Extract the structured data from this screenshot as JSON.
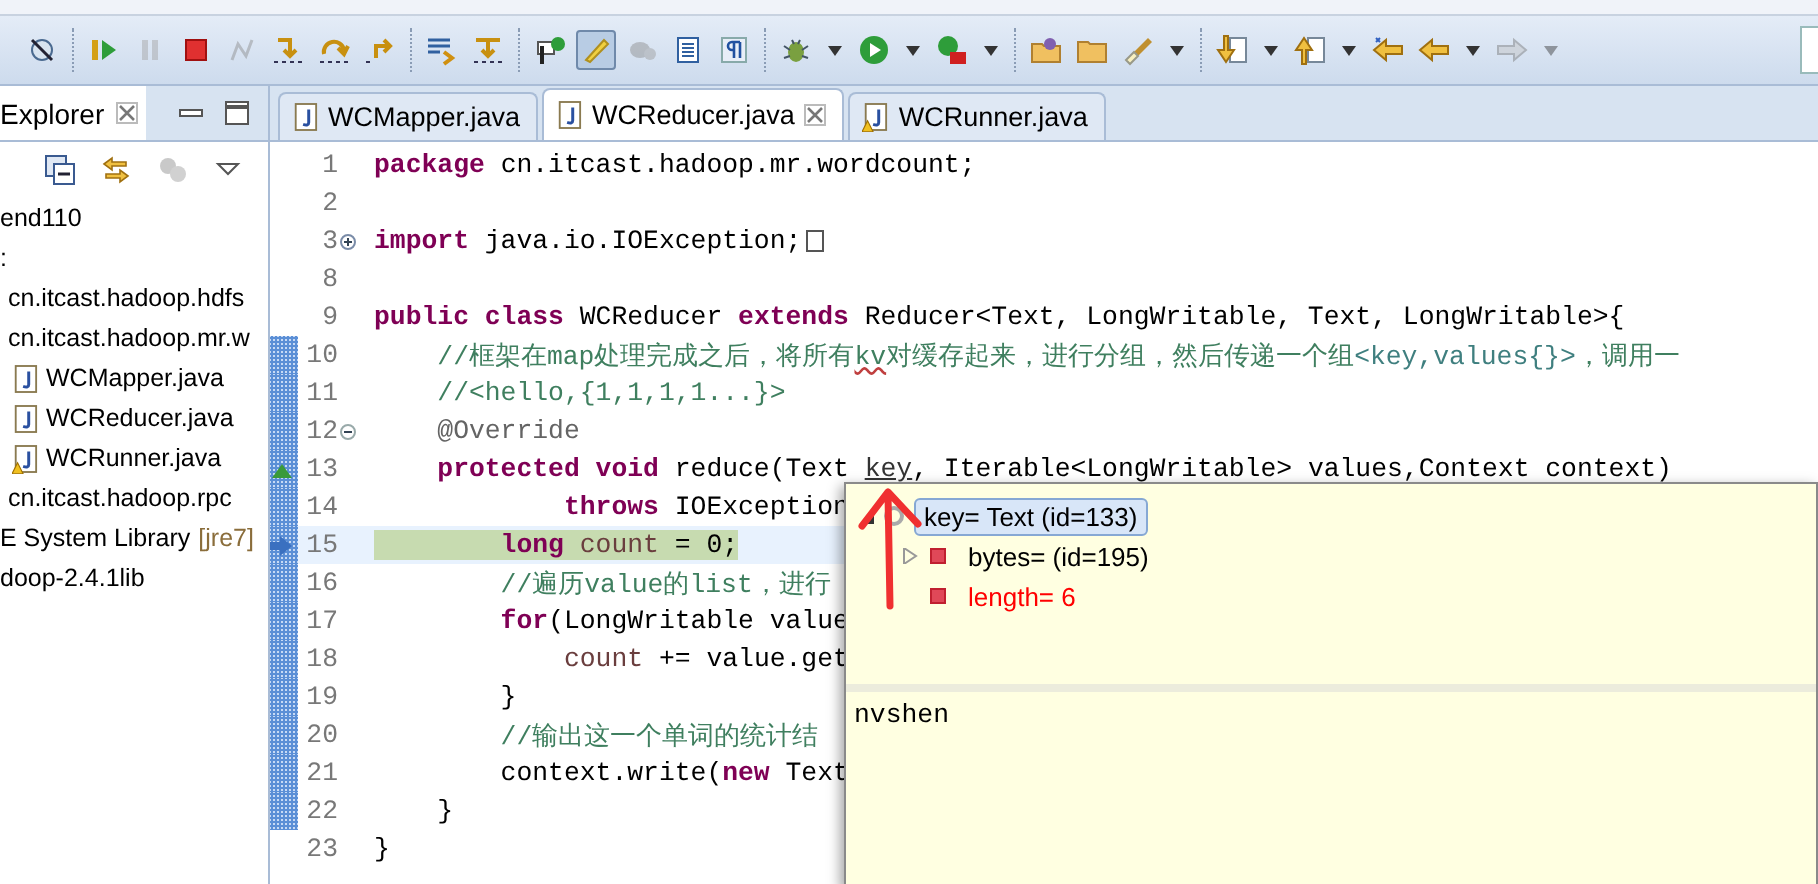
{
  "toolbar": [
    [
      {
        "kind": "skip-breakpoints",
        "disabled": false,
        "pressed": false
      }
    ],
    [
      {
        "kind": "resume",
        "disabled": false,
        "pressed": false
      },
      {
        "kind": "suspend",
        "disabled": true,
        "pressed": false
      },
      {
        "kind": "terminate",
        "disabled": false,
        "pressed": false
      },
      {
        "kind": "disconnect",
        "disabled": true,
        "pressed": false
      },
      {
        "kind": "step-into",
        "disabled": false,
        "pressed": false
      },
      {
        "kind": "step-over",
        "disabled": false,
        "pressed": false
      },
      {
        "kind": "step-return",
        "disabled": false,
        "pressed": false
      }
    ],
    [
      {
        "kind": "drop-to-frame",
        "disabled": false,
        "pressed": false
      },
      {
        "kind": "step-filters",
        "disabled": false,
        "pressed": false
      }
    ],
    [
      {
        "kind": "flag",
        "disabled": false,
        "pressed": false
      },
      {
        "kind": "pencil",
        "disabled": false,
        "pressed": true
      },
      {
        "kind": "occurrences",
        "disabled": true,
        "pressed": false
      },
      {
        "kind": "document",
        "disabled": false,
        "pressed": false
      },
      {
        "kind": "pilcrow",
        "disabled": false,
        "pressed": false
      }
    ],
    [
      {
        "kind": "debug",
        "disabled": false,
        "pressed": false
      },
      {
        "kind": "dropdown",
        "disabled": false,
        "pressed": false
      },
      {
        "kind": "run",
        "disabled": false,
        "pressed": false
      },
      {
        "kind": "dropdown",
        "disabled": false,
        "pressed": false
      },
      {
        "kind": "external-tools",
        "disabled": false,
        "pressed": false
      },
      {
        "kind": "dropdown",
        "disabled": false,
        "pressed": false
      }
    ],
    [
      {
        "kind": "project-folder",
        "disabled": false,
        "pressed": false
      },
      {
        "kind": "folder",
        "disabled": false,
        "pressed": false
      },
      {
        "kind": "brush",
        "disabled": false,
        "pressed": false
      },
      {
        "kind": "dropdown",
        "disabled": false,
        "pressed": false
      }
    ],
    [
      {
        "kind": "next-annotation",
        "disabled": false,
        "pressed": false
      },
      {
        "kind": "dropdown",
        "disabled": false,
        "pressed": false
      },
      {
        "kind": "prev-annotation",
        "disabled": false,
        "pressed": false
      },
      {
        "kind": "dropdown",
        "disabled": false,
        "pressed": false
      },
      {
        "kind": "last-edit",
        "disabled": false,
        "pressed": false
      },
      {
        "kind": "back",
        "disabled": false,
        "pressed": false
      },
      {
        "kind": "dropdown",
        "disabled": false,
        "pressed": false
      },
      {
        "kind": "forward",
        "disabled": true,
        "pressed": false
      },
      {
        "kind": "dropdown",
        "disabled": true,
        "pressed": false
      }
    ]
  ],
  "explorer": {
    "title": "Explorer",
    "items": [
      {
        "label": "end110",
        "children": [
          {
            "label": ":",
            "children": [
              {
                "label": "cn.itcast.hadoop.hdfs"
              },
              {
                "label": "cn.itcast.hadoop.mr.w",
                "children": [
                  {
                    "label": "WCMapper.java",
                    "kind": "file",
                    "warning": false
                  },
                  {
                    "label": "WCReducer.java",
                    "kind": "file",
                    "warning": false
                  },
                  {
                    "label": "WCRunner.java",
                    "kind": "file",
                    "warning": true
                  }
                ]
              },
              {
                "label": "cn.itcast.hadoop.rpc"
              }
            ]
          },
          {
            "label": "E System Library",
            "suffix": "[jre7]"
          },
          {
            "label": "doop-2.4.1lib"
          }
        ]
      }
    ]
  },
  "editor": {
    "tabs": [
      {
        "label": "WCMapper.java",
        "selected": false,
        "warning": false
      },
      {
        "label": "WCReducer.java",
        "selected": true,
        "warning": false
      },
      {
        "label": "WCRunner.java",
        "selected": false,
        "warning": true
      }
    ],
    "lines": [
      {
        "number": "1",
        "in_range": false,
        "current": false,
        "tokens": [
          {
            "kind": "keyword",
            "text": "package"
          },
          {
            "kind": "plain",
            "text": " cn.itcast.hadoop.mr.wordcount;"
          }
        ]
      },
      {
        "number": "2",
        "in_range": false,
        "current": false
      },
      {
        "number": "3",
        "in_range": false,
        "current": false,
        "fold": {
          "kind": "expand"
        },
        "tokens": [
          {
            "kind": "keyword",
            "text": "import"
          },
          {
            "kind": "plain",
            "text": " java.io.IOException;"
          }
        ]
      },
      {
        "number": "8",
        "in_range": false,
        "current": false
      },
      {
        "number": "9",
        "in_range": false,
        "current": false,
        "tokens": [
          {
            "kind": "keyword",
            "text": "public class"
          },
          {
            "kind": "plain",
            "text": " WCReducer "
          },
          {
            "kind": "keyword",
            "text": "extends"
          },
          {
            "kind": "plain",
            "text": " Reducer<Text, LongWritable, Text, LongWritable>{"
          }
        ]
      },
      {
        "number": "10",
        "in_range": true,
        "current": false,
        "tokens": [
          {
            "kind": "comment",
            "text": "    //框架在map处理完成之后，将所有"
          },
          {
            "kind": "spelling",
            "text": "kv"
          },
          {
            "kind": "comment",
            "text": "对缓存起来，进行分组，然后传递一个组"
          },
          {
            "kind": "comment-tag",
            "text": "<key,values{}>"
          },
          {
            "kind": "comment",
            "text": "，调用一"
          }
        ]
      },
      {
        "number": "11",
        "in_range": true,
        "current": false,
        "tokens": [
          {
            "kind": "comment",
            "text": "    //<hello,{1,1,1,1...}>"
          }
        ]
      },
      {
        "number": "12",
        "in_range": true,
        "current": false,
        "fold": {
          "kind": "collapse"
        },
        "tokens": [
          {
            "kind": "annotation",
            "text": "    @Override"
          }
        ]
      },
      {
        "number": "13",
        "in_range": true,
        "current": false,
        "marker": {
          "kind": "override"
        },
        "tokens": [
          {
            "kind": "keyword",
            "text": "    protected void"
          },
          {
            "kind": "plain",
            "text": " reduce(Text "
          },
          {
            "kind": "link",
            "text": "key"
          },
          {
            "kind": "plain",
            "text": ", Iterable<LongWritable> values,Context context)"
          }
        ]
      },
      {
        "number": "14",
        "in_range": true,
        "current": false,
        "tokens": [
          {
            "kind": "keyword",
            "text": "            throws"
          },
          {
            "kind": "plain",
            "text": " IOException"
          }
        ]
      },
      {
        "number": "15",
        "in_range": true,
        "current": true,
        "marker": {
          "kind": "instruction"
        },
        "tokens": [
          {
            "kind": "keyword",
            "text": "        long"
          },
          {
            "kind": "local",
            "text": " count"
          },
          {
            "kind": "plain",
            "text": " = 0;"
          }
        ]
      },
      {
        "number": "16",
        "in_range": true,
        "current": false,
        "tokens": [
          {
            "kind": "comment",
            "text": "        //遍历value的list，进行"
          }
        ]
      },
      {
        "number": "17",
        "in_range": true,
        "current": false,
        "tokens": [
          {
            "kind": "keyword",
            "text": "        for"
          },
          {
            "kind": "plain",
            "text": "(LongWritable value"
          }
        ]
      },
      {
        "number": "18",
        "in_range": true,
        "current": false,
        "tokens": [
          {
            "kind": "local",
            "text": "            count"
          },
          {
            "kind": "plain",
            "text": " += value.get"
          }
        ]
      },
      {
        "number": "19",
        "in_range": true,
        "current": false,
        "tokens": [
          {
            "kind": "plain",
            "text": "        }"
          }
        ]
      },
      {
        "number": "20",
        "in_range": true,
        "current": false,
        "tokens": [
          {
            "kind": "comment",
            "text": "        //输出这一个单词的统计结"
          }
        ]
      },
      {
        "number": "21",
        "in_range": true,
        "current": false,
        "tokens": [
          {
            "kind": "plain",
            "text": "        context.write("
          },
          {
            "kind": "keyword",
            "text": "new"
          },
          {
            "kind": "plain",
            "text": " Text"
          }
        ]
      },
      {
        "number": "22",
        "in_range": true,
        "current": false,
        "tokens": [
          {
            "kind": "plain",
            "text": "    }"
          }
        ]
      },
      {
        "number": "23",
        "in_range": false,
        "current": false,
        "tokens": [
          {
            "kind": "plain",
            "text": "}"
          }
        ]
      }
    ]
  },
  "hover": {
    "tree": [
      {
        "label": "key= Text  (id=133)",
        "kind": "local",
        "selected": true,
        "changed": false,
        "expanded": true,
        "children": [
          {
            "label": "bytes= (id=195)",
            "kind": "field",
            "selected": false,
            "changed": false,
            "expanded": false
          },
          {
            "label": "length= 6",
            "kind": "field",
            "selected": false,
            "changed": true
          }
        ]
      }
    ],
    "detail": "nvshen"
  }
}
